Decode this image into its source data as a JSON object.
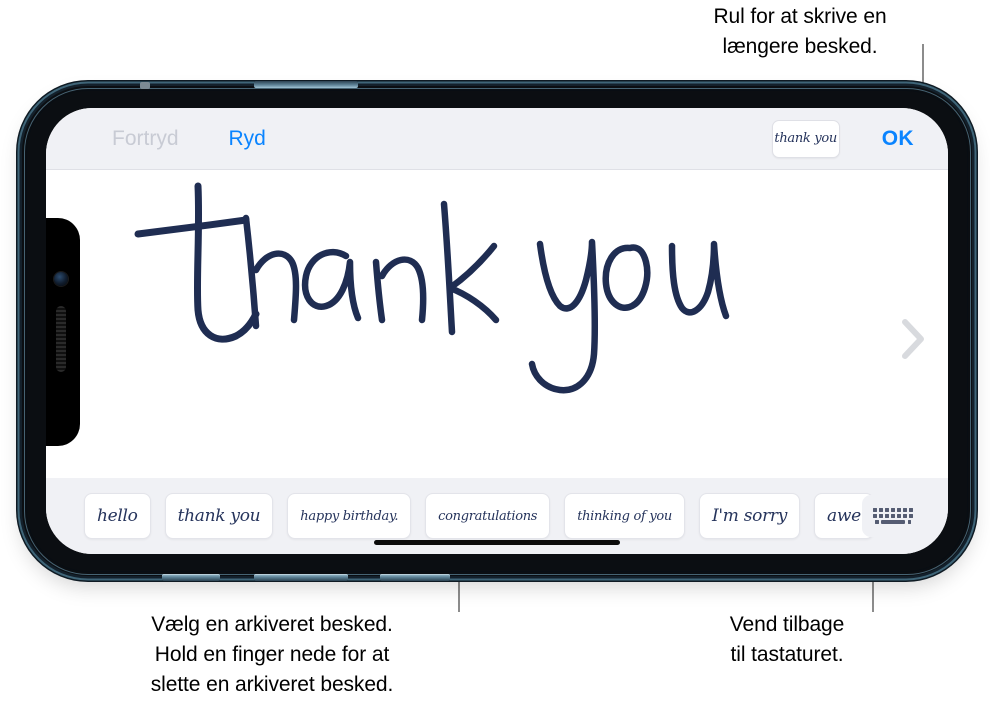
{
  "callouts": {
    "top": "Rul for at skrive en\nlængere besked.",
    "bottom_left": "Vælg en arkiveret besked.\nHold en finger nede for at\nslette en arkiveret besked.",
    "bottom_right": "Vend tilbage\ntil tastaturet."
  },
  "toolbar": {
    "undo_label": "Fortryd",
    "clear_label": "Ryd",
    "ok_label": "OK",
    "preview_text": "thank you"
  },
  "canvas": {
    "handwriting_text": "thank you",
    "ink_color": "#1f2d52",
    "scroll_chevron": "chevron-right"
  },
  "saved_messages": [
    {
      "text": "hello",
      "size": "normal"
    },
    {
      "text": "thank you",
      "size": "normal"
    },
    {
      "text": "happy birthday.",
      "size": "small"
    },
    {
      "text": "congratulations",
      "size": "small"
    },
    {
      "text": "thinking of you",
      "size": "small"
    },
    {
      "text": "I'm sorry",
      "size": "normal"
    },
    {
      "text": "awe",
      "size": "normal"
    }
  ],
  "keyboard_button": {
    "icon": "keyboard-icon"
  },
  "colors": {
    "accent_blue": "#0a84ff",
    "disabled_grey": "#c8cbd4",
    "toolbar_bg": "#f0f1f5",
    "ink": "#1f2d52",
    "callout_text": "#000000",
    "leader_line": "#8c8c8c"
  }
}
